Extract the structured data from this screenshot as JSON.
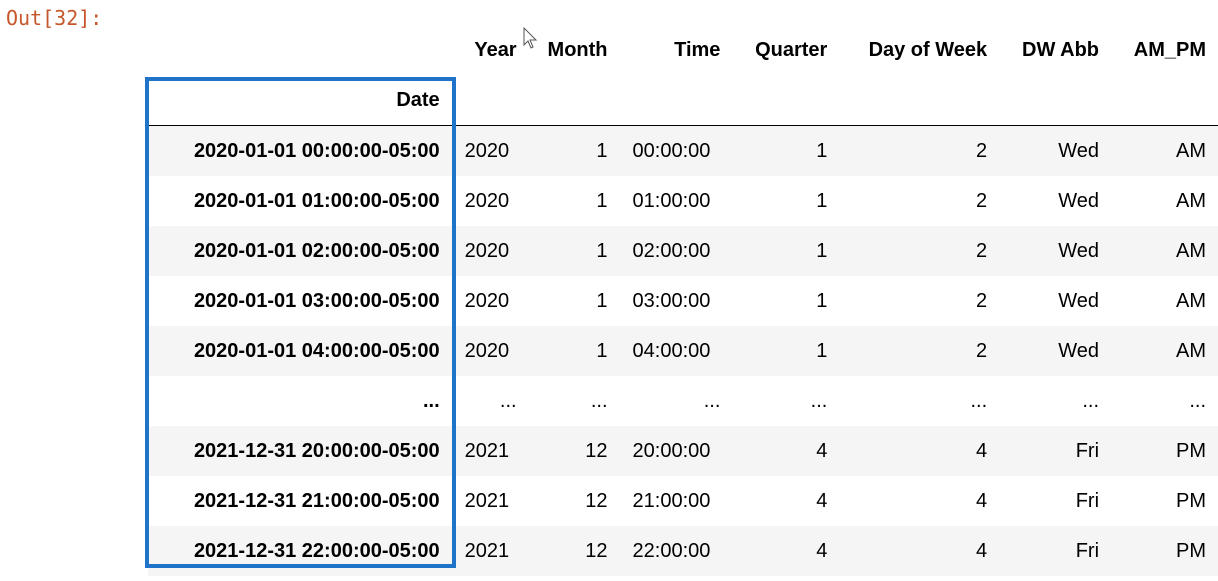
{
  "prompt": "Out[32]:",
  "columns": [
    "Year",
    "Month",
    "Time",
    "Quarter",
    "Day of Week",
    "DW Abb",
    "AM_PM"
  ],
  "index_name": "Date",
  "highlight_color": "#1f73c8",
  "rows": [
    {
      "index": "2020-01-01 00:00:00-05:00",
      "cells": [
        "2020",
        "1",
        "00:00:00",
        "1",
        "2",
        "Wed",
        "AM"
      ]
    },
    {
      "index": "2020-01-01 01:00:00-05:00",
      "cells": [
        "2020",
        "1",
        "01:00:00",
        "1",
        "2",
        "Wed",
        "AM"
      ]
    },
    {
      "index": "2020-01-01 02:00:00-05:00",
      "cells": [
        "2020",
        "1",
        "02:00:00",
        "1",
        "2",
        "Wed",
        "AM"
      ]
    },
    {
      "index": "2020-01-01 03:00:00-05:00",
      "cells": [
        "2020",
        "1",
        "03:00:00",
        "1",
        "2",
        "Wed",
        "AM"
      ]
    },
    {
      "index": "2020-01-01 04:00:00-05:00",
      "cells": [
        "2020",
        "1",
        "04:00:00",
        "1",
        "2",
        "Wed",
        "AM"
      ]
    },
    {
      "index": "...",
      "cells": [
        "...",
        "...",
        "...",
        "...",
        "...",
        "...",
        "..."
      ]
    },
    {
      "index": "2021-12-31 20:00:00-05:00",
      "cells": [
        "2021",
        "12",
        "20:00:00",
        "4",
        "4",
        "Fri",
        "PM"
      ]
    },
    {
      "index": "2021-12-31 21:00:00-05:00",
      "cells": [
        "2021",
        "12",
        "21:00:00",
        "4",
        "4",
        "Fri",
        "PM"
      ]
    },
    {
      "index": "2021-12-31 22:00:00-05:00",
      "cells": [
        "2021",
        "12",
        "22:00:00",
        "4",
        "4",
        "Fri",
        "PM"
      ]
    }
  ]
}
